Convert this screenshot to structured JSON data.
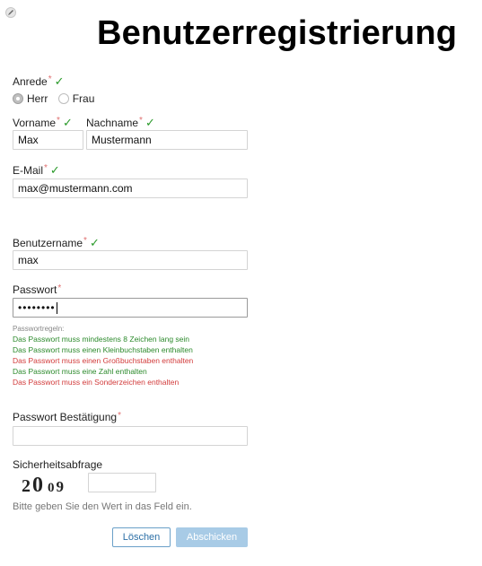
{
  "page": {
    "title": "Benutzerregistrierung"
  },
  "form": {
    "salutation": {
      "label": "Anrede",
      "required_mark": "*",
      "check": "✓",
      "options": [
        {
          "label": "Herr",
          "checked": true
        },
        {
          "label": "Frau",
          "checked": false
        }
      ]
    },
    "firstname": {
      "label": "Vorname",
      "required_mark": "*",
      "check": "✓",
      "value": "Max"
    },
    "lastname": {
      "label": "Nachname",
      "required_mark": "*",
      "check": "✓",
      "value": "Mustermann"
    },
    "email": {
      "label": "E-Mail",
      "required_mark": "*",
      "check": "✓",
      "value": "max@mustermann.com"
    },
    "username": {
      "label": "Benutzername",
      "required_mark": "*",
      "check": "✓",
      "value": "max"
    },
    "password": {
      "label": "Passwort",
      "required_mark": "*",
      "value": "••••••••"
    },
    "password_rules": {
      "heading": "Passwortregeln:",
      "rules": [
        {
          "text": "Das Passwort muss mindestens 8 Zeichen lang sein",
          "status": "ok"
        },
        {
          "text": "Das Passwort muss einen Kleinbuchstaben enthalten",
          "status": "ok"
        },
        {
          "text": "Das Passwort muss einen Großbuchstaben enthalten",
          "status": "bad"
        },
        {
          "text": "Das Passwort muss eine Zahl enthalten",
          "status": "ok"
        },
        {
          "text": "Das Passwort muss ein Sonderzeichen enthalten",
          "status": "bad"
        }
      ]
    },
    "password_confirm": {
      "label": "Passwort Bestätigung",
      "required_mark": "*",
      "value": ""
    },
    "captcha": {
      "label": "Sicherheitsabfrage",
      "digits": [
        "2",
        "0",
        "0",
        "9"
      ],
      "value": "",
      "hint": "Bitte geben Sie den Wert in das Feld ein."
    },
    "buttons": {
      "clear": "Löschen",
      "submit": "Abschicken"
    }
  },
  "colors": {
    "ok": "#2c8a2c",
    "bad": "#d23b3b",
    "check": "#2a9a2a",
    "required": "#e07070",
    "button_border": "#6aa0c8",
    "submit_bg": "#a8cbe6"
  },
  "icons": {
    "top_left": "pencil-edit-icon",
    "check": "checkmark-icon"
  }
}
